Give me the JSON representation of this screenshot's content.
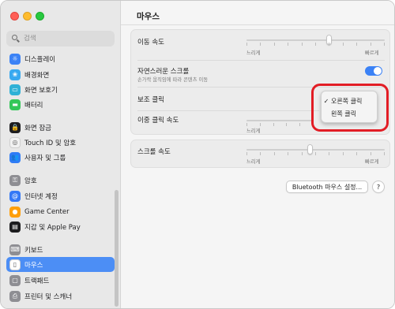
{
  "search": {
    "placeholder": "검색"
  },
  "sidebar": {
    "items": [
      {
        "label": "디스플레이",
        "icon": "display-icon",
        "color": "#3b82f6",
        "glyph": "☼"
      },
      {
        "label": "배경화면",
        "icon": "wallpaper-icon",
        "color": "#38a9f0",
        "glyph": "❀"
      },
      {
        "label": "화면 보호기",
        "icon": "screensaver-icon",
        "color": "#2fb1d6",
        "glyph": "▭"
      },
      {
        "label": "배터리",
        "icon": "battery-icon",
        "color": "#34c759",
        "glyph": "▬"
      },
      {
        "label": "화면 잠금",
        "icon": "lock-icon",
        "color": "#1c1c1e",
        "glyph": "🔒"
      },
      {
        "label": "Touch ID 및 암호",
        "icon": "fingerprint-icon",
        "color": "#f2f2f2",
        "glyph": "◎"
      },
      {
        "label": "사용자 및 그룹",
        "icon": "users-icon",
        "color": "#2f7cf6",
        "glyph": "👥"
      },
      {
        "label": "암호",
        "icon": "key-icon",
        "color": "#8e8e93",
        "glyph": "⚿"
      },
      {
        "label": "인터넷 계정",
        "icon": "at-icon",
        "color": "#3478f6",
        "glyph": "@"
      },
      {
        "label": "Game Center",
        "icon": "game-center-icon",
        "color": "#ff9f0a",
        "glyph": "●"
      },
      {
        "label": "지갑 및 Apple Pay",
        "icon": "wallet-icon",
        "color": "#1c1c1e",
        "glyph": "▤"
      },
      {
        "label": "키보드",
        "icon": "keyboard-icon",
        "color": "#8e8e93",
        "glyph": "⌨"
      },
      {
        "label": "마우스",
        "icon": "mouse-icon",
        "color": "#ffffff",
        "glyph": "▯"
      },
      {
        "label": "트랙패드",
        "icon": "trackpad-icon",
        "color": "#8e8e93",
        "glyph": "▢"
      },
      {
        "label": "프린터 및 스캐너",
        "icon": "printer-icon",
        "color": "#8e8e93",
        "glyph": "⎙"
      }
    ]
  },
  "main": {
    "title": "마우스",
    "tracking_speed": {
      "label": "이동 속도",
      "min_label": "느리게",
      "max_label": "빠르게",
      "value": 0.6
    },
    "natural_scroll": {
      "label": "자연스러운 스크롤",
      "description": "손가락 움직임에 따라 콘텐츠 이동",
      "enabled": true
    },
    "secondary_click": {
      "label": "보조 클릭"
    },
    "double_click_speed": {
      "label": "이중 클릭 속도",
      "min_label": "느리게"
    },
    "scroll_speed": {
      "label": "스크롤 속도",
      "min_label": "느리게",
      "max_label": "빠르게",
      "value": 0.46
    },
    "bluetooth_button": "Bluetooth 마우스 설정...",
    "help_button": "?"
  },
  "popup": {
    "options": [
      {
        "label": "오른쪽 클릭",
        "checked": true
      },
      {
        "label": "왼쪽 클릭",
        "checked": false
      }
    ],
    "checkmark": "✓"
  },
  "colors": {
    "accent": "#3b82f6",
    "selection": "#4c8ef5",
    "highlight": "#e21d25"
  }
}
